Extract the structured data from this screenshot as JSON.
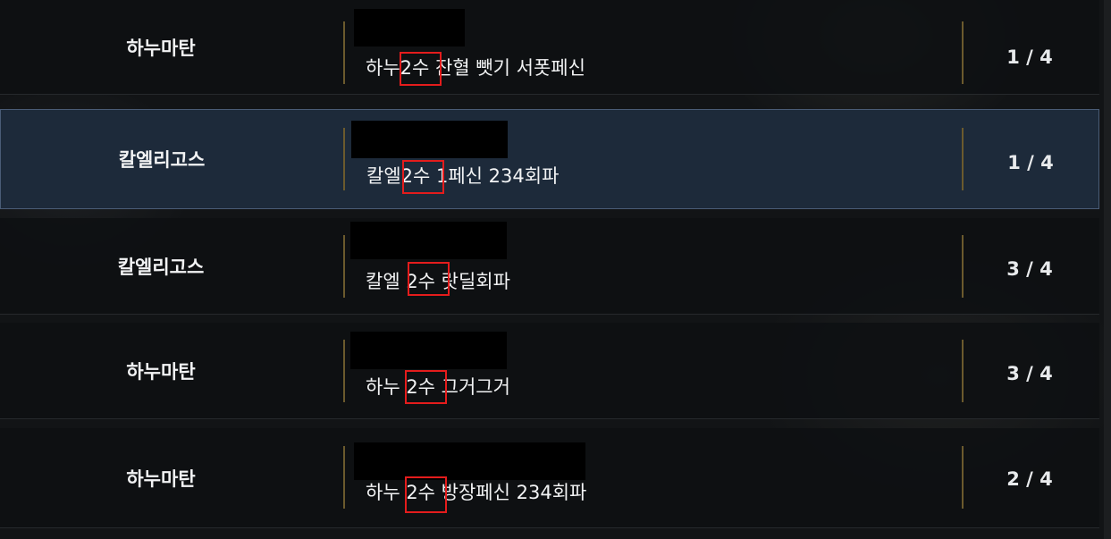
{
  "rooms": [
    {
      "guild": "하누마탄",
      "title": "하누2수 잔혈 뺏기 서폿페신",
      "count": "1 / 4",
      "selected": false
    },
    {
      "guild": "칼엘리고스",
      "title": "칼엘2수 1페신 234회파",
      "count": "1 / 4",
      "selected": true
    },
    {
      "guild": "칼엘리고스",
      "title": "칼엘 2수 랏딜회파",
      "count": "3 / 4",
      "selected": false
    },
    {
      "guild": "하누마탄",
      "title": "하누 2수 그거그거",
      "count": "3 / 4",
      "selected": false
    },
    {
      "guild": "하누마탄",
      "title": "하누 2수 방장페신 234회파",
      "count": "2 / 4",
      "selected": false
    }
  ],
  "colors": {
    "selected_bg": "#1d2a3a",
    "selected_border": "#4a5c76",
    "divider_gold": "#6b5a2d",
    "highlight_red": "#e41c1c"
  }
}
